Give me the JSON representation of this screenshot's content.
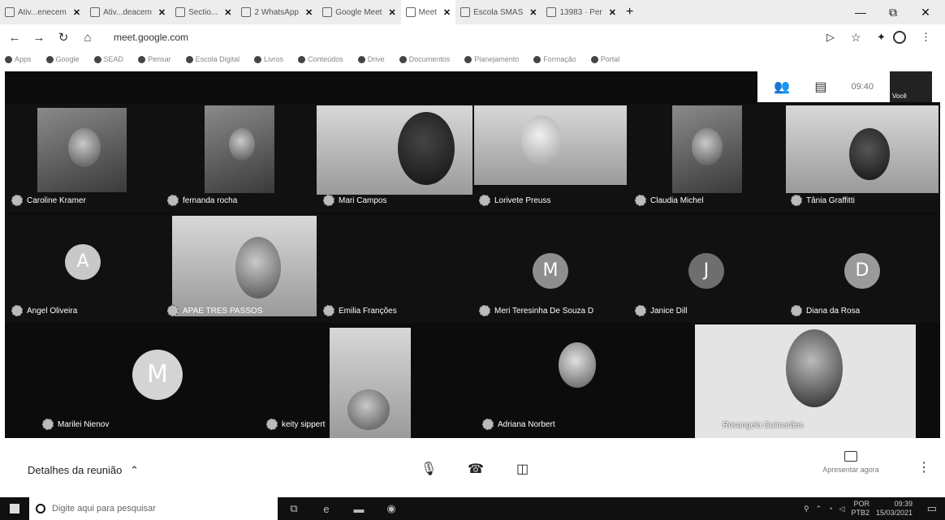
{
  "tabs": [
    {
      "label": "Ativ...enecem"
    },
    {
      "label": "Ativ...deacem"
    },
    {
      "label": "Sectio..."
    },
    {
      "label": "2 WhatsApp"
    },
    {
      "label": "Google Meet"
    },
    {
      "label": "Meet"
    },
    {
      "label": "Escola SMAS"
    },
    {
      "label": "13983 · Per"
    }
  ],
  "browser": {
    "url": "meet.google.com",
    "new_tab": "+",
    "minimize": "—",
    "maximize": "⧉",
    "close": "✕"
  },
  "bookmarks": [
    {
      "label": "Apps"
    },
    {
      "label": "Google"
    },
    {
      "label": "SEAD"
    },
    {
      "label": "Pensar"
    },
    {
      "label": "Escola Digital"
    },
    {
      "label": "Livros"
    },
    {
      "label": "Conteúdos"
    },
    {
      "label": "Drive"
    },
    {
      "label": "Documentos"
    },
    {
      "label": "Planejamento"
    },
    {
      "label": "Formação"
    },
    {
      "label": "Portal"
    }
  ],
  "meet": {
    "clock": "09:40",
    "self_label": "Você",
    "participants": [
      {
        "name": "Caroline Kramer"
      },
      {
        "name": "fernanda rocha"
      },
      {
        "name": "Mari Campos"
      },
      {
        "name": "Lorivete Preuss"
      },
      {
        "name": "Claudia Michel"
      },
      {
        "name": "Tânia Graffitti"
      },
      {
        "name": "Angel Oliveira",
        "initial": "A",
        "avatar_color": "#c8c8c8"
      },
      {
        "name": "APAE TRES PASSOS"
      },
      {
        "name": "Emilia Franções"
      },
      {
        "name": "Meri Teresinha De Souza D",
        "initial": "M",
        "avatar_color": "#8e8e8e"
      },
      {
        "name": "Janice Dill",
        "initial": "J",
        "avatar_color": "#6e6e6e"
      },
      {
        "name": "Diana da Rosa",
        "initial": "D",
        "avatar_color": "#9a9a9a"
      },
      {
        "name": "Marilei Nienov",
        "initial": "M",
        "avatar_color": "#d4d4d4"
      },
      {
        "name": "keity sippert"
      },
      {
        "name": "Adriana Norbert"
      },
      {
        "name": "Rosangela Guimarães"
      }
    ],
    "details_label": "Detalhes da reunião",
    "present_label": "Apresentar agora"
  },
  "taskbar": {
    "search_placeholder": "Digite aqui para pesquisar",
    "lang": "POR",
    "layout": "PTB2",
    "time": "09:39",
    "date": "15/03/2021"
  }
}
